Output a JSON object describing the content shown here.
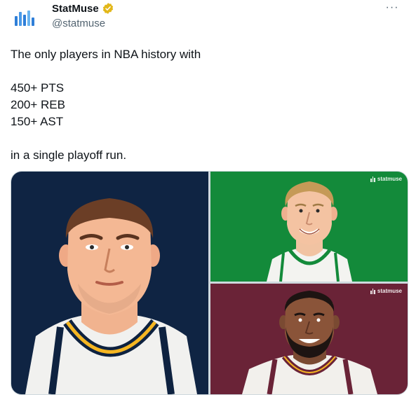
{
  "tweet": {
    "author": {
      "name": "StatMuse",
      "handle": "@statmuse",
      "verified": true,
      "avatar_icon": "statmuse-logo-icon",
      "brand_color": "#4a90d9"
    },
    "more_icon": "more-options-icon",
    "text": {
      "line1": "The only players in NBA history with",
      "line2": "450+ PTS",
      "line3": "200+ REB",
      "line4": "150+ AST",
      "line5": "in a single playoff run."
    },
    "media": {
      "watermark": "statmuse",
      "panels": [
        {
          "id": "left",
          "background": "#0f2443",
          "jersey": "Denver"
        },
        {
          "id": "top-right",
          "background": "#138a3a",
          "jersey": "Boston"
        },
        {
          "id": "bottom-right",
          "background": "#6a2337",
          "jersey": "Cleveland"
        }
      ]
    }
  }
}
